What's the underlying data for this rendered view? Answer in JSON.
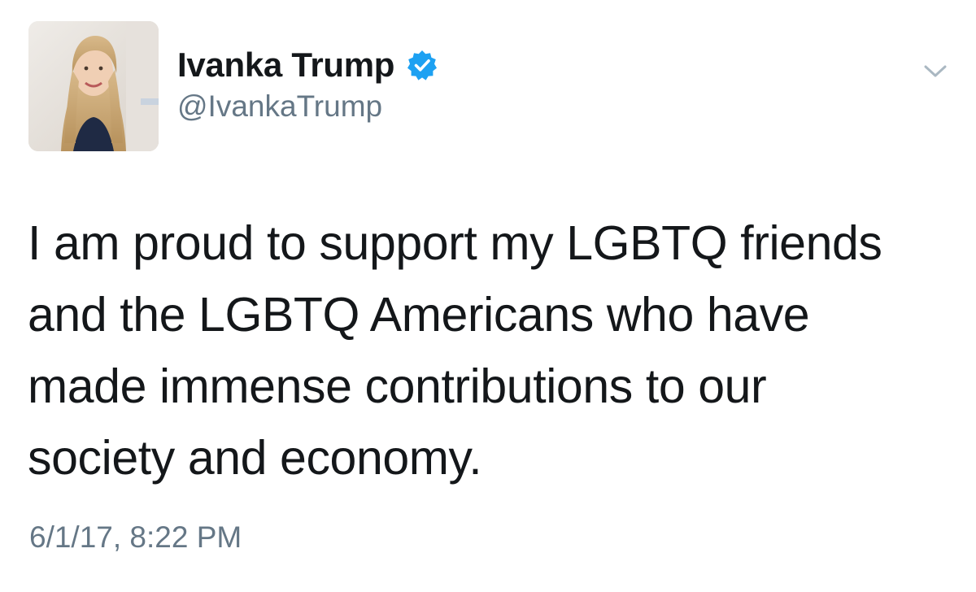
{
  "author": {
    "display_name": "Ivanka Trump",
    "handle": "@IvankaTrump",
    "verified": true,
    "avatar_icon": "profile-photo",
    "verified_icon": "verified-badge-icon"
  },
  "menu": {
    "icon": "chevron-down-icon"
  },
  "tweet": {
    "lines": [
      "I am proud to support my LGBTQ friends",
      "and the LGBTQ Americans who have",
      "made immense contributions to our",
      "society and economy."
    ],
    "timestamp": "6/1/17, 8:22 PM"
  },
  "colors": {
    "text_primary": "#14171a",
    "text_secondary": "#657786",
    "verified_blue": "#1da1f2",
    "background": "#ffffff"
  }
}
